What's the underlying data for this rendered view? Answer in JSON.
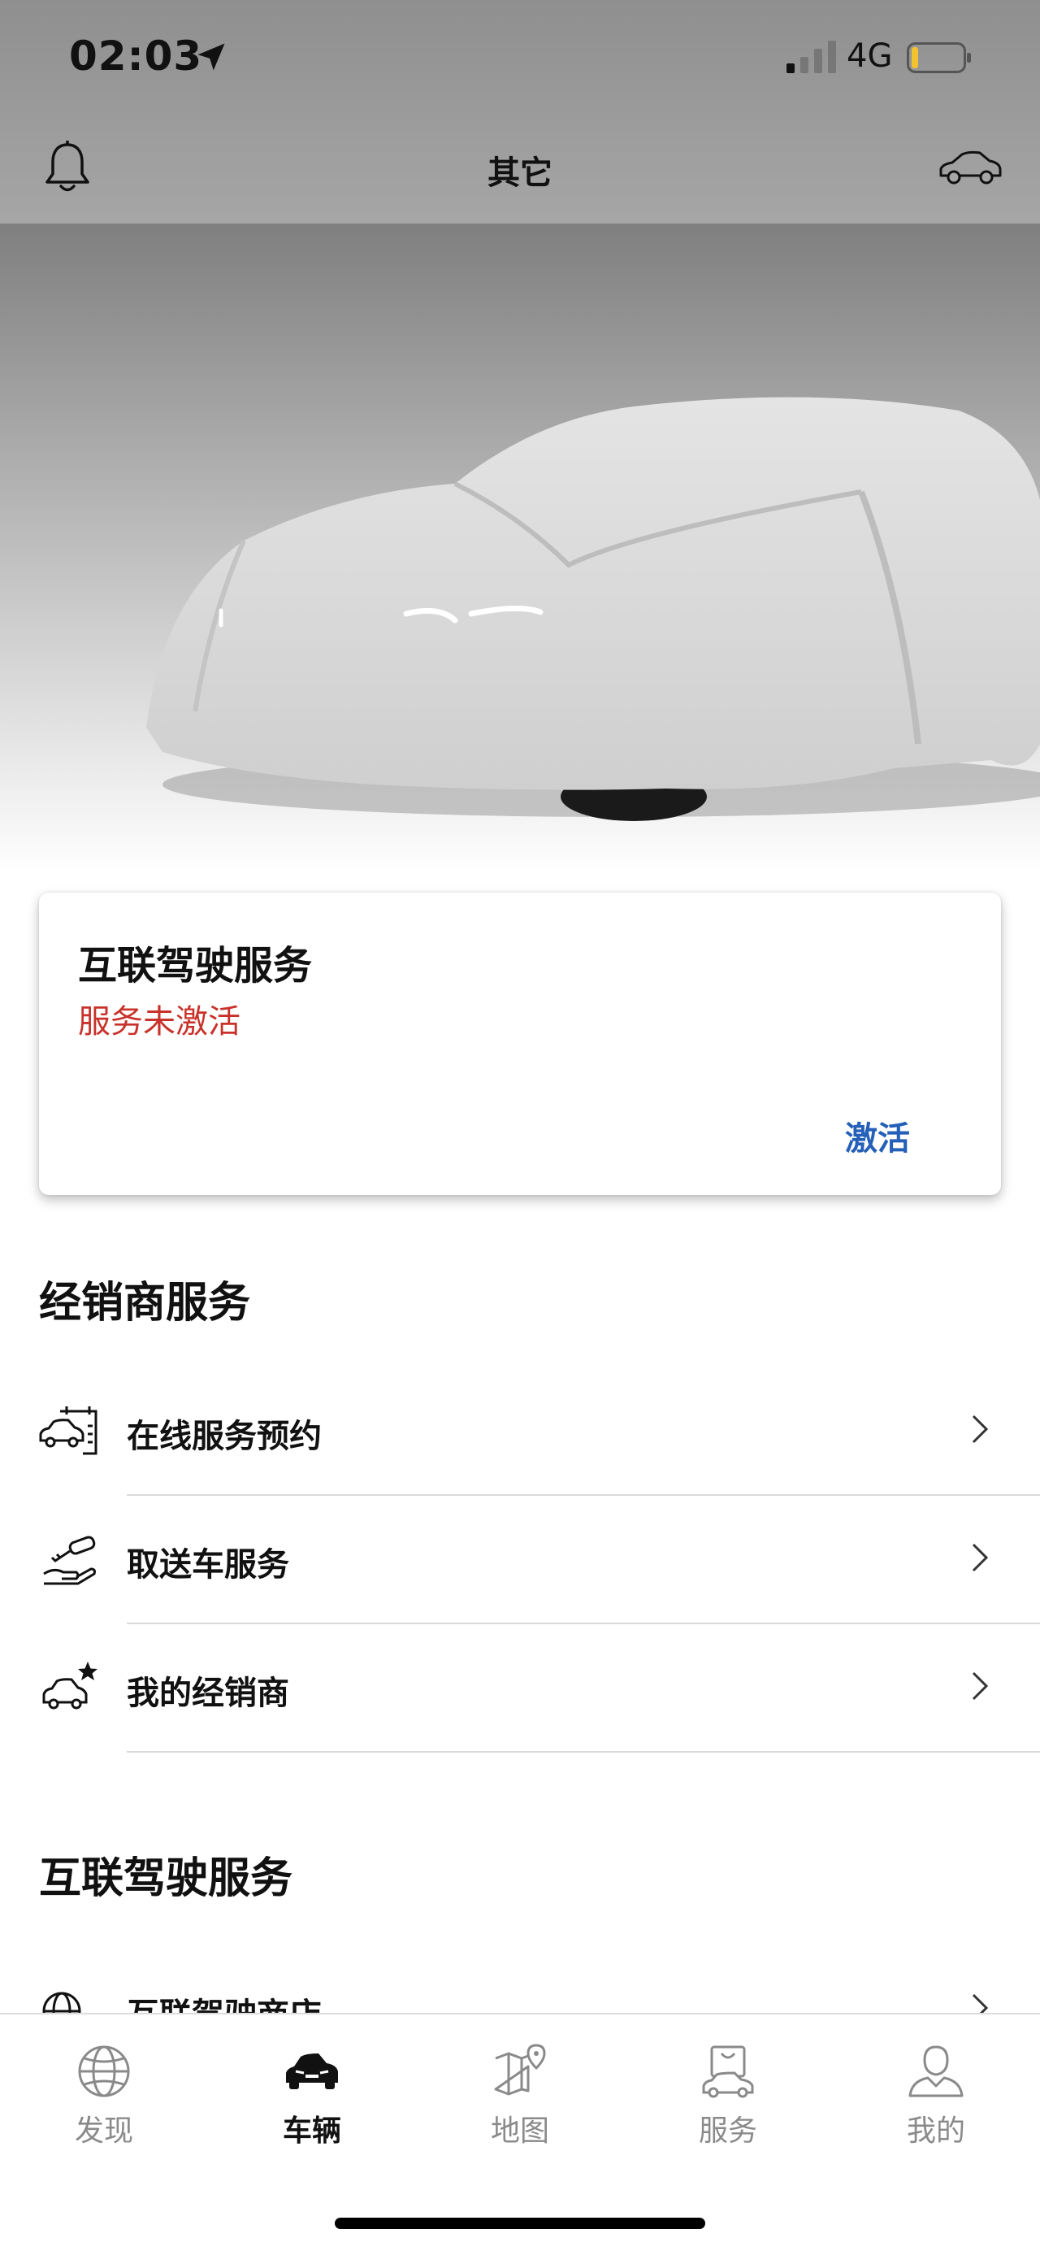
{
  "status_bar": {
    "time": "02:03",
    "network": "4G"
  },
  "header": {
    "title": "其它"
  },
  "connected_card": {
    "title": "互联驾驶服务",
    "status": "服务未激活",
    "action": "激活",
    "status_color": "#c8322a",
    "action_color": "#2560b8"
  },
  "dealer_section": {
    "title": "经销商服务",
    "items": [
      {
        "label": "在线服务预约",
        "icon": "car-service-calendar-icon"
      },
      {
        "label": "取送车服务",
        "icon": "car-key-hand-icon"
      },
      {
        "label": "我的经销商",
        "icon": "car-star-icon"
      }
    ]
  },
  "connected_section": {
    "title": "互联驾驶服务",
    "items": [
      {
        "label": "互联驾驶商店",
        "icon": "globe-store-icon"
      }
    ]
  },
  "tabs": [
    {
      "label": "发现",
      "icon": "globe-icon",
      "active": false
    },
    {
      "label": "车辆",
      "icon": "car-icon",
      "active": true
    },
    {
      "label": "地图",
      "icon": "map-icon",
      "active": false
    },
    {
      "label": "服务",
      "icon": "shopping-bag-car-icon",
      "active": false
    },
    {
      "label": "我的",
      "icon": "user-icon",
      "active": false
    }
  ]
}
